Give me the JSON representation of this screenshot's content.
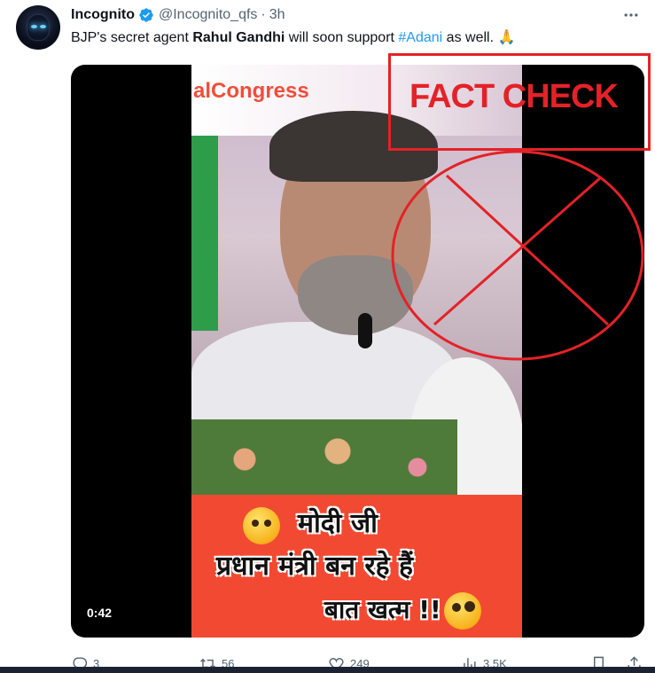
{
  "tweet": {
    "author_name": "Incognito",
    "handle": "@Incognito_qfs",
    "separator": "·",
    "time": "3h",
    "text_parts": {
      "p1": "BJP's secret agent ",
      "bold": "Rahul Gandhi",
      "p2": " will soon support ",
      "hashtag": "#Adani",
      "p3": " as well. 🙏"
    }
  },
  "media": {
    "banner_text": "alCongress",
    "caption_line1": "मोदी जी",
    "caption_line2": "प्रधान मंत्री बन रहे हैं",
    "caption_line3": "बात खत्म !!",
    "duration": "0:42"
  },
  "overlay": {
    "stamp_text": "FACT CHECK",
    "color": "#e32228"
  },
  "actions": {
    "replies": "3",
    "retweets": "56",
    "likes": "249",
    "views": "3.5K"
  },
  "colors": {
    "accent": "#1d9bf0",
    "secondary_text": "#536471",
    "caption_bg": "#f24a32"
  }
}
